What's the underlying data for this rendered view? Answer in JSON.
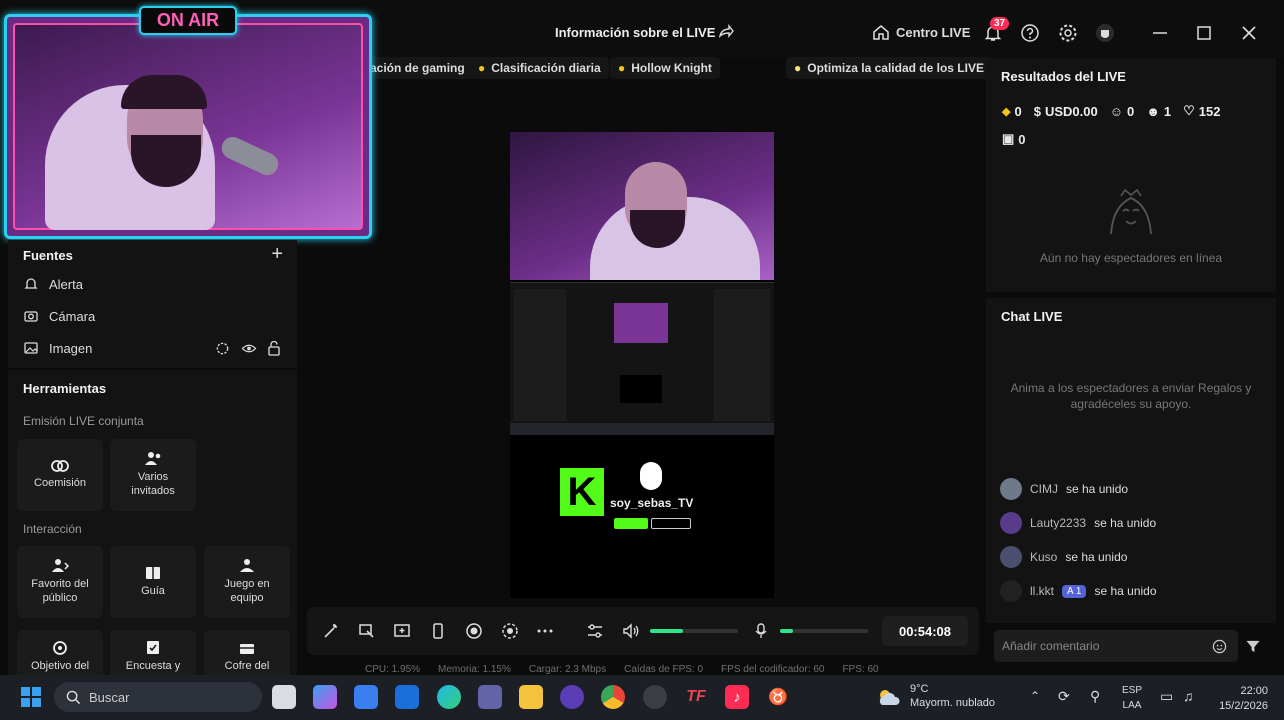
{
  "header": {
    "title": "Información sobre el LIVE",
    "centro_live": "Centro LIVE",
    "notification_count": "37"
  },
  "chips": [
    "ación de gaming",
    "Clasificación diaria",
    "Hollow Knight"
  ],
  "optimize_label": "Optimiza la calidad de los LIVE",
  "camera_overlay": {
    "on_air": "ON AIR"
  },
  "sources": {
    "title": "Fuentes",
    "items": [
      {
        "label": "Alerta",
        "icon": "bell-icon"
      },
      {
        "label": "Cámara",
        "icon": "camera-icon"
      },
      {
        "label": "Imagen",
        "icon": "image-icon"
      }
    ]
  },
  "tools": {
    "title": "Herramientas",
    "cohost_title": "Emisión LIVE conjunta",
    "cohost": [
      {
        "label": "Coemisión",
        "icon": "link-icon"
      },
      {
        "label": "Varios invitados",
        "icon": "group-icon"
      }
    ],
    "interaction_title": "Interacción",
    "interaction": [
      {
        "label": "Favorito del público",
        "icon": "favorite-icon"
      },
      {
        "label": "Guía",
        "icon": "guide-icon"
      },
      {
        "label": "Juego en equipo",
        "icon": "team-game-icon"
      }
    ],
    "more": [
      {
        "label": "Objetivo del",
        "icon": "goal-icon"
      },
      {
        "label": "Encuesta y",
        "icon": "poll-icon"
      },
      {
        "label": "Cofre del",
        "icon": "chest-icon"
      }
    ]
  },
  "preview": {
    "channel_name": "soy_sebas_TV",
    "kick_letter": "K"
  },
  "controls": {
    "timer": "00:54:08",
    "volume_level": 0.38,
    "mic_level": 0.15
  },
  "stats": {
    "cpu": "CPU: 1.95%",
    "memory": "Memoria: 1.15%",
    "upload": "Cargar: 2.3 Mbps",
    "fps_drops": "Caídas de FPS: 0",
    "encoder_fps": "FPS del codificador: 60",
    "fps": "FPS: 60"
  },
  "results": {
    "title": "Resultados del LIVE",
    "diamonds": "0",
    "usd": "USD0.00",
    "viewers": "0",
    "new_followers": "1",
    "likes": "152",
    "gifts": "0",
    "empty_text": "Aún no hay espectadores en línea"
  },
  "chat": {
    "title": "Chat LIVE",
    "prompt": "Anima a los espectadores a enviar Regalos y agradéceles su apoyo.",
    "messages": [
      {
        "user": "CIMJ",
        "text": "se ha unido",
        "level": ""
      },
      {
        "user": "Lauty2233",
        "text": "se ha unido",
        "level": ""
      },
      {
        "user": "Kuso",
        "text": "se ha unido",
        "level": ""
      },
      {
        "user": "ll.kkt",
        "text": "se ha unido",
        "level": "1"
      }
    ],
    "comment_placeholder": "Añadir comentario"
  },
  "taskbar": {
    "search_placeholder": "Buscar",
    "weather_temp": "9°C",
    "weather_desc": "Mayorm. nublado",
    "lang": "ESP",
    "layout": "LAA",
    "time": "22:00",
    "date": "15/2/2026"
  },
  "colors": {
    "accent": "#fe2c55",
    "neon": "#29d0f0",
    "kick_green": "#53fc18"
  }
}
